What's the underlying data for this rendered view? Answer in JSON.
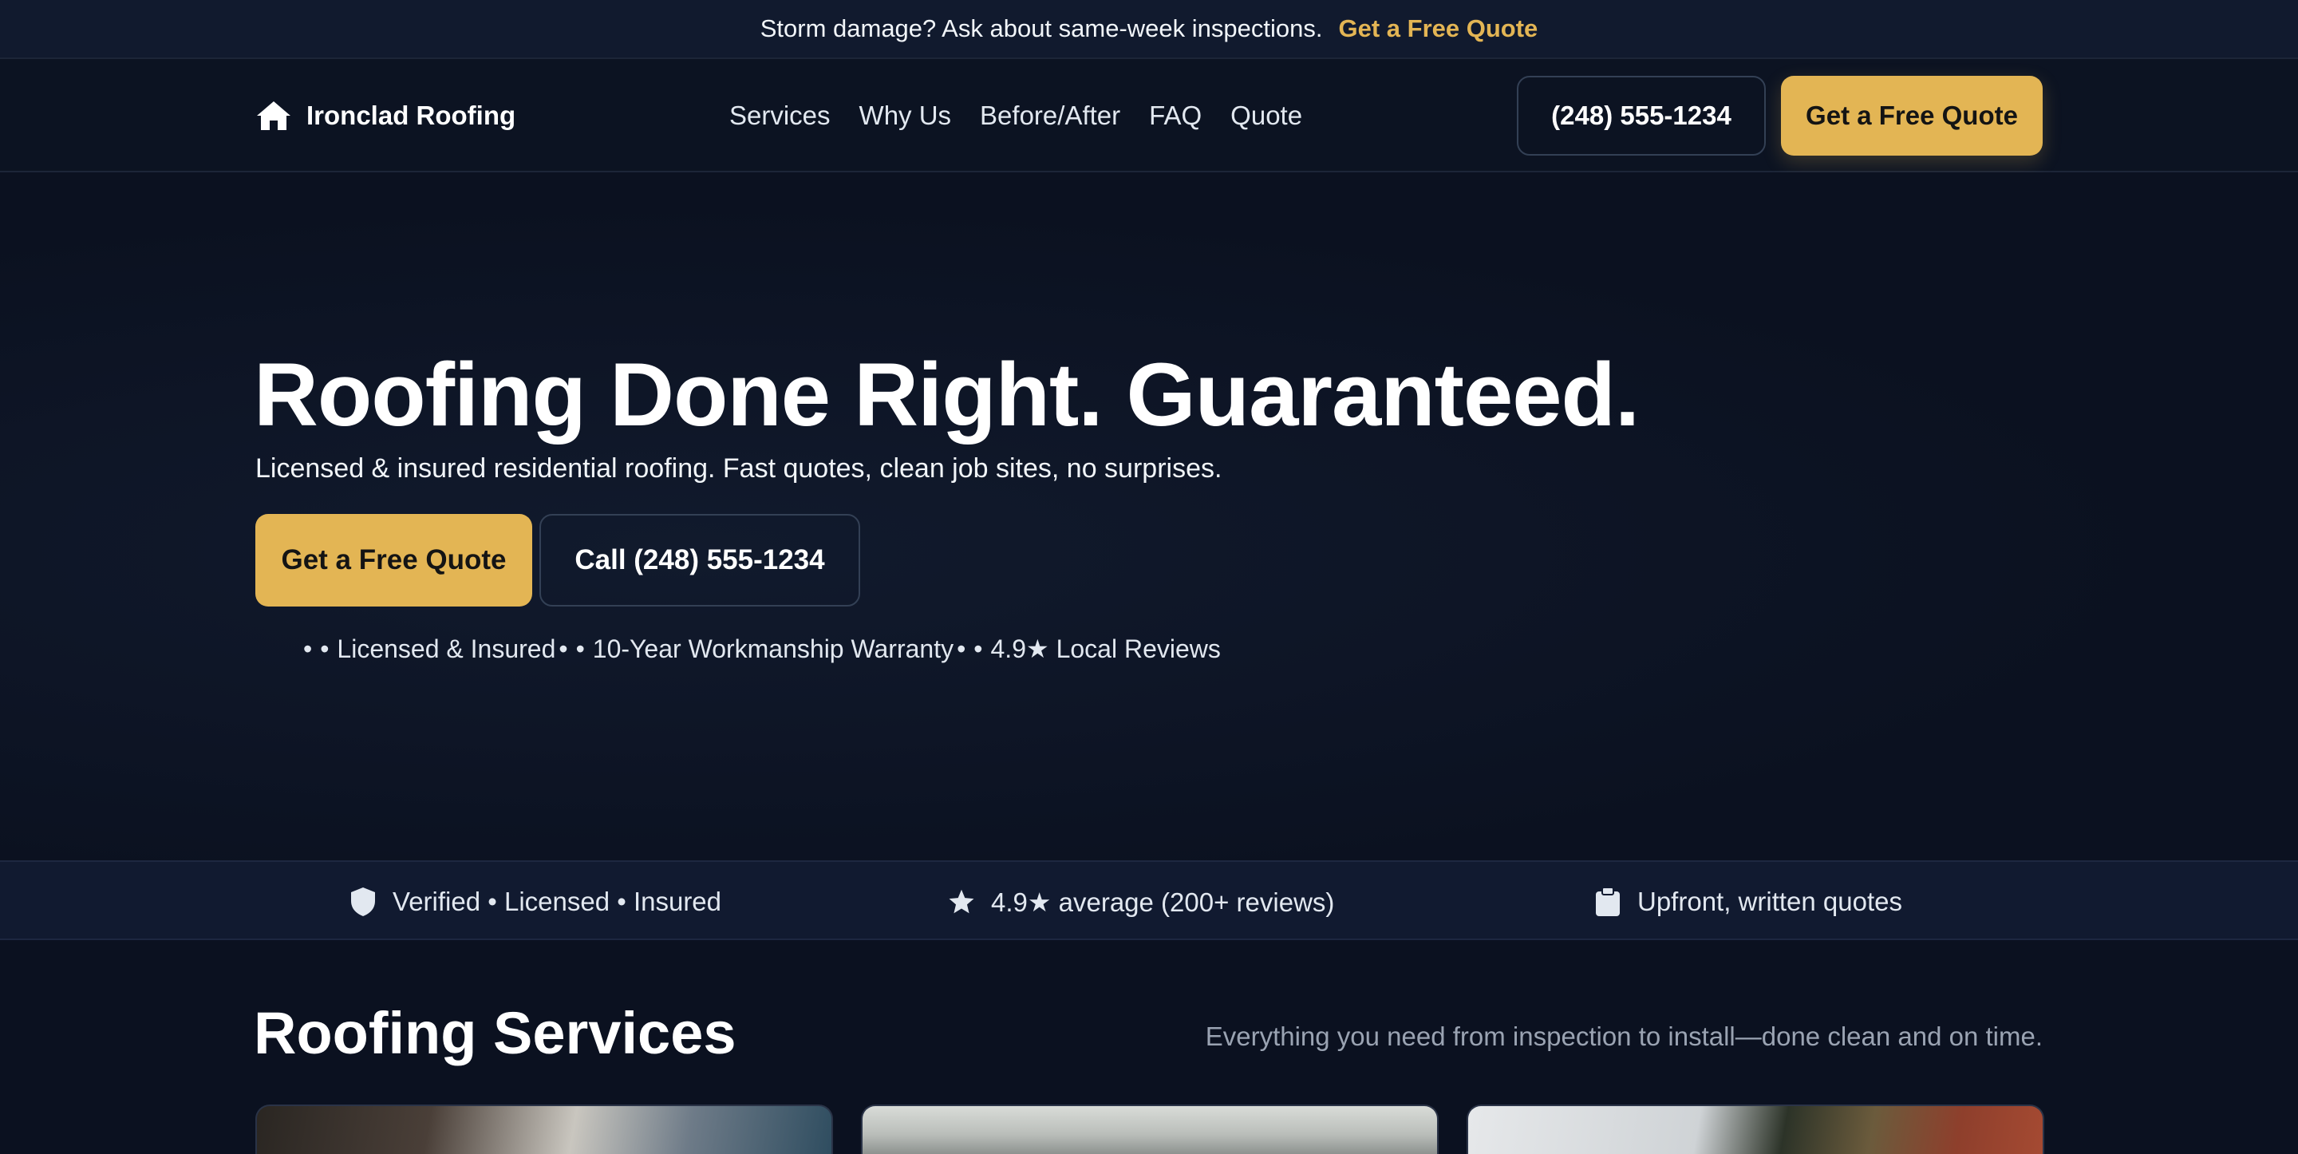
{
  "topbar": {
    "message": "Storm damage? Ask about same-week inspections.",
    "cta": "Get a Free Quote"
  },
  "header": {
    "brand": "Ironclad Roofing",
    "brand_icon": "house-icon",
    "nav": [
      "Services",
      "Why Us",
      "Before/After",
      "FAQ",
      "Quote"
    ],
    "phone": "(248) 555-1234",
    "quote_button": "Get a Free Quote"
  },
  "hero": {
    "title": "Roofing Done Right. Guaranteed.",
    "subtitle": "Licensed & insured residential roofing. Fast quotes, clean job sites, no surprises.",
    "primary_button": "Get a Free Quote",
    "secondary_button": "Call (248) 555-1234",
    "badges": [
      "Licensed & Insured",
      "10-Year Workmanship Warranty",
      "4.9★ Local Reviews"
    ],
    "bullet": "•"
  },
  "trust": [
    {
      "icon": "shield-icon",
      "text": "Verified • Licensed • Insured"
    },
    {
      "icon": "star-icon",
      "text": "4.9★ average (200+ reviews)"
    },
    {
      "icon": "clipboard-icon",
      "text": "Upfront, written quotes"
    }
  ],
  "services": {
    "title": "Roofing Services",
    "subtitle": "Everything you need from inspection to install—done clean and on time."
  },
  "colors": {
    "accent": "#e3b554",
    "background": "#0b1120",
    "header": "#0c1322",
    "trust_strip": "#111a30"
  }
}
